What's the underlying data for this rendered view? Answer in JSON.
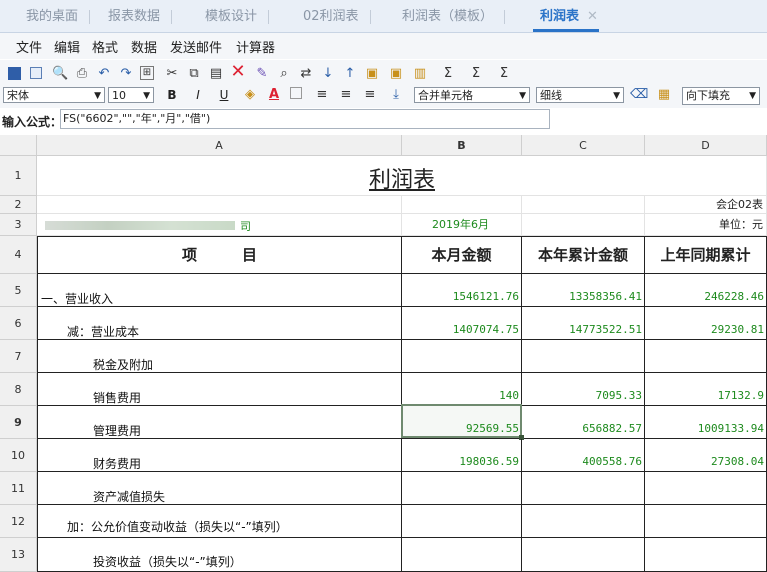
{
  "tabs": [
    {
      "label": "我的桌面"
    },
    {
      "label": "报表数据"
    },
    {
      "label": "模板设计"
    },
    {
      "label": "02利润表"
    },
    {
      "label": "利润表（模板）"
    },
    {
      "label": "利润表"
    }
  ],
  "tab_close_glyph": "✕",
  "menu": [
    "文件",
    "编辑",
    "格式",
    "数据",
    "发送邮件",
    "计算器"
  ],
  "toolbar": {
    "font_name": "宋体",
    "font_size": "10",
    "merge_cells": "合并单元格",
    "border_style": "细线",
    "fill_down": "向下填充",
    "bold": "B",
    "italic": "I",
    "underline": "U"
  },
  "formula": {
    "label": "输入公式：",
    "value": "FS(\"6602\",\"\",\"年\",\"月\",\"借\")"
  },
  "columns": [
    "A",
    "B",
    "C",
    "D"
  ],
  "rows": [
    "1",
    "2",
    "3",
    "4",
    "5",
    "6",
    "7",
    "8",
    "9",
    "10",
    "11",
    "12",
    "13"
  ],
  "sheet": {
    "title": "利润表",
    "form_code": "会企02表",
    "company_suffix": "司",
    "period": "2019年6月",
    "unit": "单位：元",
    "header_item": "项　　　目",
    "header_b": "本月金额",
    "header_c": "本年累计金额",
    "header_d": "上年同期累计",
    "lines": [
      {
        "item": "一、营业收入",
        "b": "1546121.76",
        "c": "13358356.41",
        "d": "246228.46"
      },
      {
        "item": "减：营业成本",
        "b": "1407074.75",
        "c": "14773522.51",
        "d": "29230.81"
      },
      {
        "item": "税金及附加",
        "b": "",
        "c": "",
        "d": ""
      },
      {
        "item": "销售费用",
        "b": "140",
        "c": "7095.33",
        "d": "17132.9"
      },
      {
        "item": "管理费用",
        "b": "92569.55",
        "c": "656882.57",
        "d": "1009133.94"
      },
      {
        "item": "财务费用",
        "b": "198036.59",
        "c": "400558.76",
        "d": "27308.04"
      },
      {
        "item": "资产减值损失",
        "b": "",
        "c": "",
        "d": ""
      },
      {
        "item": "加：公允价值变动收益（损失以“-”填列）",
        "b": "",
        "c": "",
        "d": ""
      },
      {
        "item": "投资收益（损失以“-”填列）",
        "b": "",
        "c": "",
        "d": ""
      }
    ]
  }
}
